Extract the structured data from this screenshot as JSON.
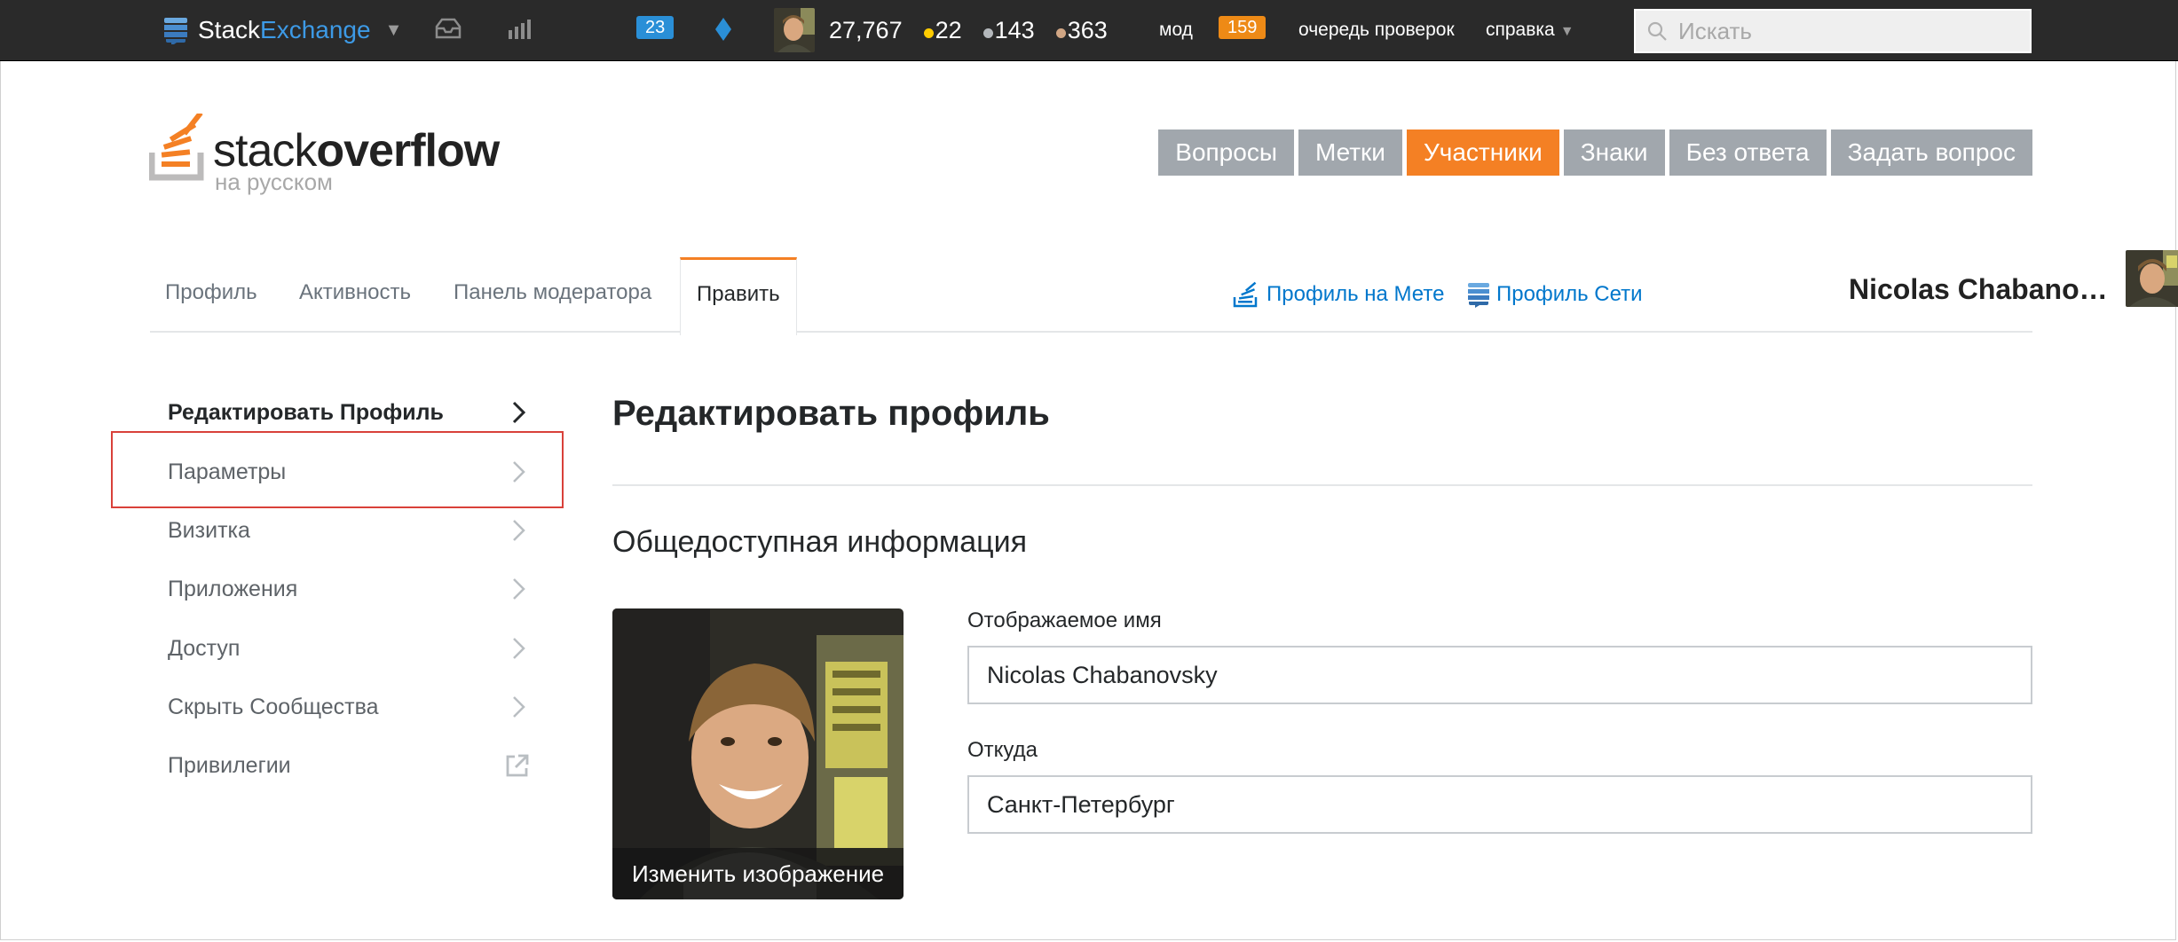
{
  "topbar": {
    "brand_part1": "Stack",
    "brand_part2": "Exchange",
    "inbox_icon": "inbox-icon",
    "achievements_icon": "achievements-icon",
    "review_badge": "23",
    "diamond_icon": "moderator-diamond-icon",
    "reputation": "27,767",
    "gold_badges": "22",
    "silver_badges": "143",
    "bronze_badges": "363",
    "mod_label": "мод",
    "mod_count": "159",
    "review_queue_label": "очередь проверок",
    "help_label": "справка",
    "search_placeholder": "Искать",
    "search_value": ""
  },
  "header": {
    "logo_word_light": "stack",
    "logo_word_bold": "overflow",
    "logo_sub": "на русском",
    "nav": [
      {
        "label": "Вопросы",
        "active": false
      },
      {
        "label": "Метки",
        "active": false
      },
      {
        "label": "Участники",
        "active": true
      },
      {
        "label": "Знаки",
        "active": false
      },
      {
        "label": "Без ответа",
        "active": false
      },
      {
        "label": "Задать вопрос",
        "active": false
      }
    ]
  },
  "profile_tabs": {
    "tabs": [
      {
        "label": "Профиль"
      },
      {
        "label": "Активность"
      },
      {
        "label": "Панель модератора"
      },
      {
        "label": "Править"
      }
    ],
    "active_tab": "Править",
    "meta_profile_link": "Профиль на Мете",
    "network_profile_link": "Профиль Сети",
    "user_name": "Nicolas Chabano…"
  },
  "sidebar": {
    "items": [
      {
        "label": "Редактировать Профиль",
        "icon": "chevron-right-icon"
      },
      {
        "label": "Параметры",
        "icon": "chevron-right-icon"
      },
      {
        "label": "Визитка",
        "icon": "chevron-right-icon"
      },
      {
        "label": "Приложения",
        "icon": "chevron-right-icon"
      },
      {
        "label": "Доступ",
        "icon": "chevron-right-icon"
      },
      {
        "label": "Скрыть Сообщества",
        "icon": "chevron-right-icon"
      },
      {
        "label": "Привилегии",
        "icon": "external-link-icon"
      }
    ],
    "active_item": "Редактировать Профиль",
    "highlighted_item": "Параметры"
  },
  "main": {
    "page_title": "Редактировать профиль",
    "section_title": "Общедоступная информация",
    "change_image_label": "Изменить изображение",
    "display_name_label": "Отображаемое имя",
    "display_name_value": "Nicolas Chabanovsky",
    "location_label": "Откуда",
    "location_value": "Санкт-Петербург"
  },
  "colors": {
    "topbar_bg": "#2a2a2a",
    "accent_orange": "#f48024",
    "nav_gray": "#a1a7ad",
    "link_blue": "#0077cc",
    "highlight_red": "#d9413a"
  }
}
